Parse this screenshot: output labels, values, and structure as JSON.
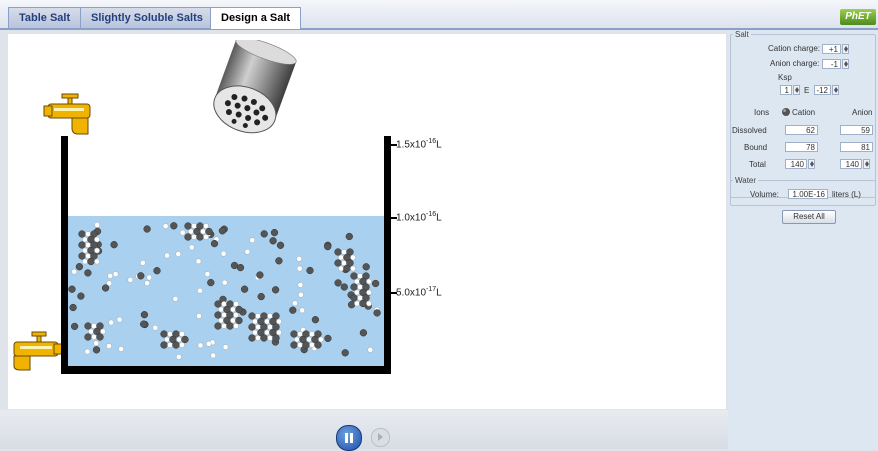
{
  "tabs": [
    {
      "label": "Table Salt",
      "active": false
    },
    {
      "label": "Slightly Soluble Salts",
      "active": false
    },
    {
      "label": "Design a Salt",
      "active": true
    }
  ],
  "logo": {
    "text": "PhET"
  },
  "panel": {
    "salt_title": "Salt",
    "cation_charge_label": "Cation charge:",
    "cation_charge_value": "+1",
    "anion_charge_label": "Anion charge:",
    "anion_charge_value": "-1",
    "ksp_label": "Ksp",
    "ksp_mantissa": "1",
    "ksp_e": "E",
    "ksp_exponent": "-12",
    "ions_label": "Ions",
    "cation_label": "Cation",
    "anion_label": "Anion",
    "dissolved_label": "Dissolved",
    "dissolved_cation": "62",
    "dissolved_anion": "59",
    "bound_label": "Bound",
    "bound_cation": "78",
    "bound_anion": "81",
    "total_label": "Total",
    "total_cation": "140",
    "total_anion": "140",
    "water_title": "Water",
    "volume_label": "Volume:",
    "volume_value": "1.00E-16",
    "volume_unit": "liters (L)",
    "reset_label": "Reset All"
  },
  "beaker": {
    "tick_top_base": "1.5x10",
    "tick_top_exp": "-16",
    "tick_mid_base": "1.0x10",
    "tick_mid_exp": "-16",
    "tick_low_base": "5.0x10",
    "tick_low_exp": "-17",
    "tick_unit": "L"
  },
  "colors": {
    "water": "#a9d1ef",
    "cation_ion": "#555555",
    "anion_ion": "#ffffff",
    "faucet": "#f0b400"
  },
  "controls": {
    "pause": "pause-button",
    "step": "step-button"
  }
}
